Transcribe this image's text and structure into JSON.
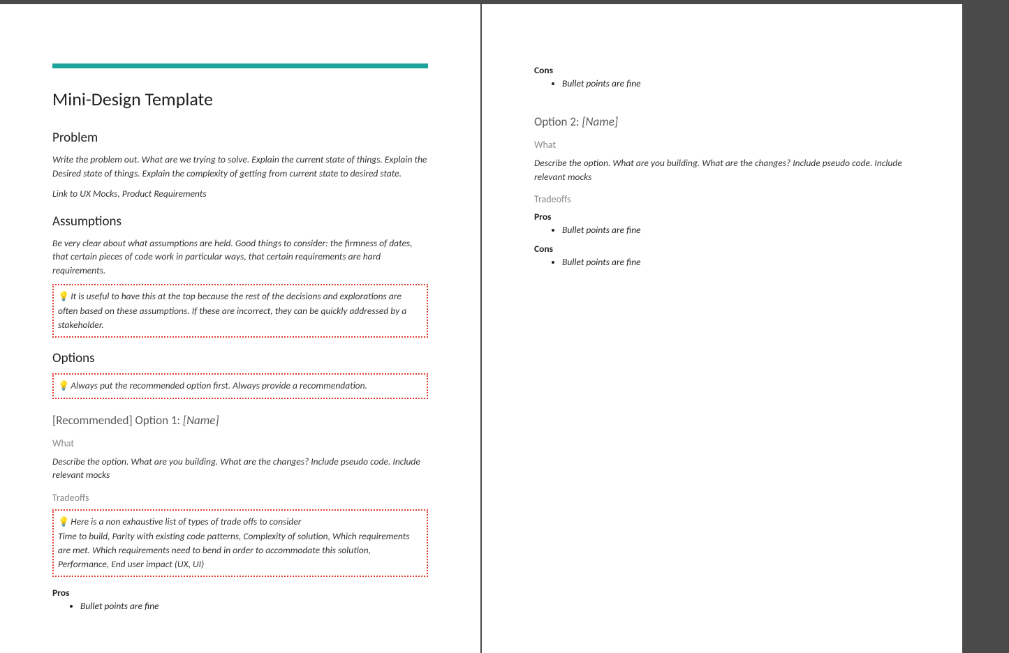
{
  "accent_color": "#1BA39C",
  "callout_border": "#e03c31",
  "doc": {
    "title": "Mini-Design Template",
    "problem": {
      "heading": "Problem",
      "p1": "Write the problem out. What are we trying to solve. Explain the current state of things. Explain the Desired state of things. Explain the complexity of getting from current state to desired state.",
      "p2": "Link to UX Mocks, Product Requirements"
    },
    "assumptions": {
      "heading": "Assumptions",
      "p1": "Be very clear about what assumptions are held. Good things to consider: the firmness of dates, that certain pieces of code work in particular ways, that certain requirements are hard requirements.",
      "callout": "It is useful  to have this at the top because the rest of the decisions and explorations are often based on these assumptions. If these are incorrect, they can be quickly addressed by a stakeholder."
    },
    "options": {
      "heading": "Options",
      "callout": "Always put the recommended option first. Always provide a recommendation.",
      "option1": {
        "heading_prefix": "[Recommended] Option 1: ",
        "heading_name": "[Name]",
        "what_heading": "What",
        "what_body": "Describe the option. What are you building. What are the changes? Include pseudo code. Include relevant mocks",
        "tradeoffs_heading": "Tradeoffs",
        "tradeoffs_callout_l1": "Here is a non exhaustive list of types of trade offs to consider",
        "tradeoffs_callout_l2": "Time to build, Parity with existing code patterns, Complexity of solution, Which requirements are met. Which requirements need to bend in order to accommodate this solution, Performance, End user impact (UX, UI)",
        "pros_label": "Pros",
        "pros_item": "Bullet points are fine",
        "cons_label": "Cons",
        "cons_item": "Bullet points are fine"
      },
      "option2": {
        "heading_prefix": "Option 2: ",
        "heading_name": "[Name]",
        "what_heading": "What",
        "what_body": "Describe the option. What are you building. What are the changes? Include pseudo code. Include relevant mocks",
        "tradeoffs_heading": "Tradeoffs",
        "pros_label": "Pros",
        "pros_item": "Bullet points are fine",
        "cons_label": "Cons",
        "cons_item": "Bullet points are fine"
      }
    },
    "bulb": "💡"
  }
}
